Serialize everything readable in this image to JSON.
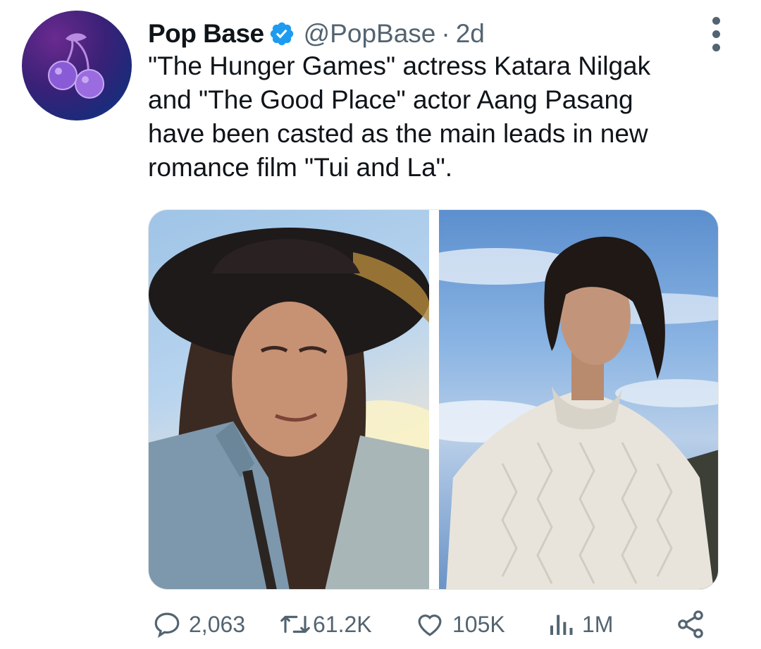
{
  "account": {
    "name": "Pop Base",
    "handle": "@PopBase",
    "separator": "·",
    "time": "2d",
    "verified": true
  },
  "tweet": {
    "text": "\"The Hunger Games\" actress Katara Nilgak\nand \"The Good Place\" actor Aang Pasang\nhave been casted as the main leads in new\nromance film \"Tui and La\"."
  },
  "media": {
    "images": [
      {
        "name": "woman-hat-photo"
      },
      {
        "name": "man-sweater-photo"
      }
    ]
  },
  "actions": {
    "replies": "2,063",
    "retweets": "61.2K",
    "likes": "105K",
    "views": "1M"
  },
  "icons": {
    "reply": "reply-icon",
    "retweet": "retweet-icon",
    "like": "heart-icon",
    "views": "views-icon",
    "share": "share-icon",
    "more": "more-icon",
    "verified": "verified-badge-icon"
  },
  "colors": {
    "text": "#0f1419",
    "secondary": "#536471",
    "verified": "#1d9bf0"
  }
}
